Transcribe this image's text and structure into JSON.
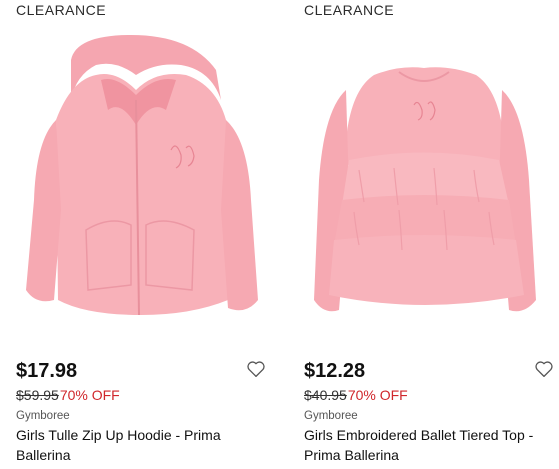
{
  "products": [
    {
      "badge": "CLEARANCE",
      "price": "$17.98",
      "original_price": "$59.95",
      "discount": "70% OFF",
      "brand": "Gymboree",
      "title": "Girls Tulle Zip Up Hoodie - Prima Ballerina",
      "image_icon": "pink-zip-hoodie-image",
      "favorite_icon": "heart-outline-icon"
    },
    {
      "badge": "CLEARANCE",
      "price": "$12.28",
      "original_price": "$40.95",
      "discount": "70% OFF",
      "brand": "Gymboree",
      "title": "Girls Embroidered Ballet Tiered Top - Prima Ballerina",
      "image_icon": "pink-tiered-top-image",
      "favorite_icon": "heart-outline-icon"
    }
  ],
  "colors": {
    "product_pink": "#f7aeb6",
    "discount_red": "#d0262b"
  }
}
